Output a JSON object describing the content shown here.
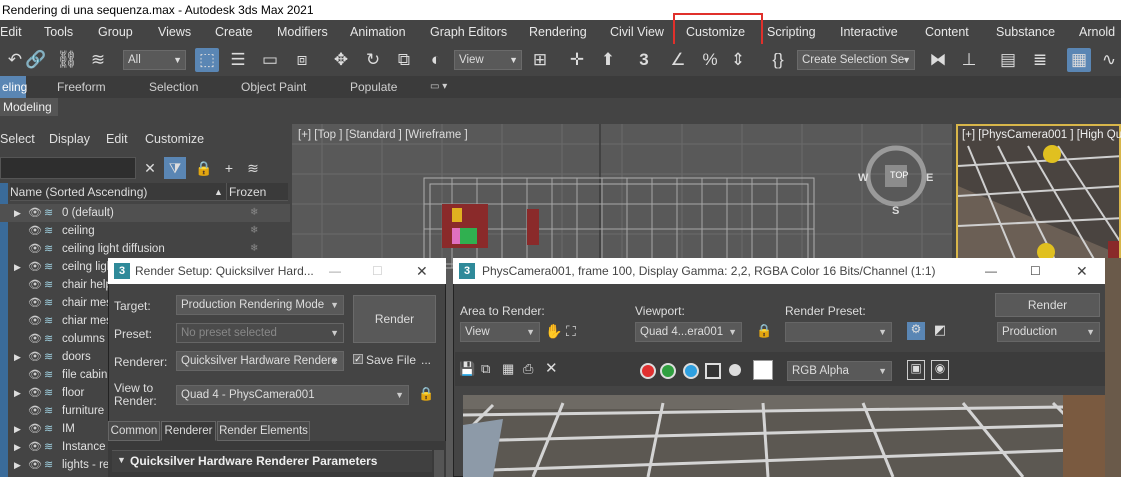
{
  "window": {
    "title": "Rendering di una sequenza.max - Autodesk 3ds Max 2021"
  },
  "menu": {
    "items": [
      "Edit",
      "Tools",
      "Group",
      "Views",
      "Create",
      "Modifiers",
      "Animation",
      "Graph Editors",
      "Rendering",
      "Civil View",
      "Customize",
      "Scripting",
      "Interactive",
      "Content",
      "Substance",
      "Arnold"
    ],
    "highlighted": "Customize",
    "highlight_color": "#e0302b"
  },
  "toolbar": {
    "filter_value": "All",
    "coord_value": "View",
    "selection_set_placeholder": "Create Selection Se",
    "icons": [
      "link-icon",
      "unlink-icon",
      "bind-spacewarp-icon",
      "select-icon",
      "select-by-name-icon",
      "rect-region-icon",
      "window-crossing-icon",
      "move-icon",
      "rotate-icon",
      "scale-icon",
      "ref-coord-icon",
      "pivot-icon",
      "select-manipulate-icon",
      "keyboard-shortcut-icon",
      "snap-3-icon",
      "angle-snap-icon",
      "percent-snap-icon",
      "spinner-snap-icon",
      "named-sets-icon",
      "mirror-icon",
      "align-icon",
      "scene-explorer-icon",
      "layer-explorer-icon",
      "toggle-ribbon-icon",
      "curve-editor-icon"
    ]
  },
  "ribbon": {
    "tabs": [
      "eling",
      "Freeform",
      "Selection",
      "Object Paint",
      "Populate"
    ],
    "modeling_label": "Modeling"
  },
  "explorer": {
    "menu": [
      "Select",
      "Display",
      "Edit",
      "Customize"
    ],
    "header_name": "Name (Sorted Ascending)",
    "header_frozen": "Frozen",
    "rows": [
      "0 (default)",
      "ceiling",
      "ceiling light diffusion",
      "ceilng ligh",
      "chair help",
      "chair mes",
      "chiar mes",
      "columns",
      "doors",
      "file cabin",
      "floor",
      "furniture",
      "IM",
      "Instance",
      "lights - re"
    ]
  },
  "viewport_top": {
    "label": "[+] [Top ] [Standard ] [Wireframe ]",
    "compass": {
      "top": "TOP",
      "w": "W",
      "e": "E",
      "s": "S"
    }
  },
  "viewport_cam": {
    "label": "[+] [PhysCamera001 ] [High Qu"
  },
  "render_setup": {
    "title": "Render Setup: Quicksilver Hard...",
    "target_label": "Target:",
    "target_value": "Production Rendering Mode",
    "preset_label": "Preset:",
    "preset_value": "No preset selected",
    "renderer_label": "Renderer:",
    "renderer_value": "Quicksilver Hardware Rendere",
    "save_file_label": "Save File",
    "more_label": "...",
    "view_label_1": "View to",
    "view_label_2": "Render:",
    "view_value": "Quad 4 - PhysCamera001",
    "render_button": "Render",
    "tabs": [
      "Common",
      "Renderer",
      "Render Elements"
    ],
    "active_tab": "Renderer",
    "section_title": "Quicksilver Hardware Renderer Parameters"
  },
  "frame_window": {
    "title": "PhysCamera001, frame 100, Display Gamma: 2,2, RGBA Color 16 Bits/Channel (1:1)",
    "area_label": "Area to Render:",
    "area_value": "View",
    "viewport_label": "Viewport:",
    "viewport_value": "Quad 4...era001",
    "preset_label": "Render Preset:",
    "preset_value": "",
    "channel_value": "RGB Alpha",
    "render_button": "Render",
    "mode_value": "Production",
    "channel_colors": {
      "red": "#e03030",
      "green": "#30a040",
      "blue": "#2fa0e0"
    }
  }
}
